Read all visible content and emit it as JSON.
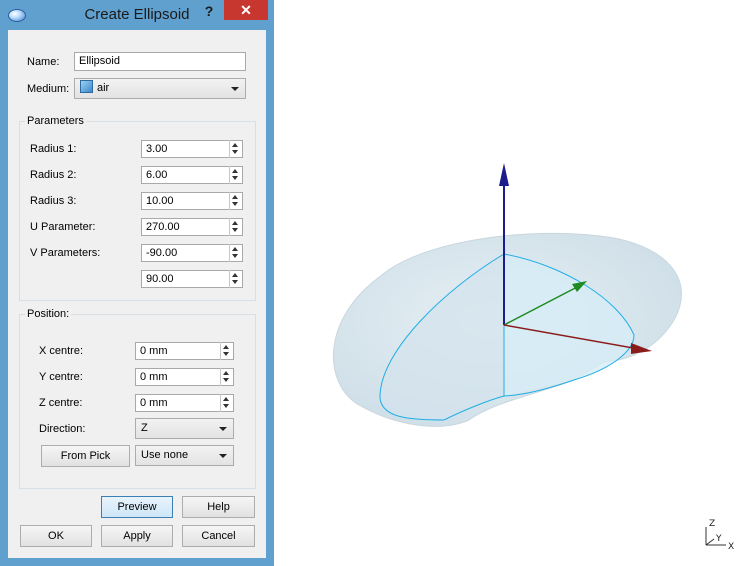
{
  "window": {
    "title": "Create Ellipsoid",
    "help_label": "?",
    "close_label": "✕"
  },
  "form": {
    "name_label": "Name:",
    "name_value": "Ellipsoid",
    "medium_label": "Medium:",
    "medium_value": "air"
  },
  "parameters": {
    "title": "Parameters",
    "rows": [
      {
        "label": "Radius 1:",
        "value": "3.00"
      },
      {
        "label": "Radius 2:",
        "value": "6.00"
      },
      {
        "label": "Radius 3:",
        "value": "10.00"
      },
      {
        "label": "U Parameter:",
        "value": "270.00"
      },
      {
        "label": "V Parameters:",
        "value": "-90.00"
      },
      {
        "label": "",
        "value": "90.00"
      }
    ]
  },
  "position": {
    "title": "Position:",
    "x_label": "X centre:",
    "x_value": "0 mm",
    "y_label": "Y centre:",
    "y_value": "0 mm",
    "z_label": "Z centre:",
    "z_value": "0 mm",
    "direction_label": "Direction:",
    "direction_value": "Z",
    "from_pick_label": "From Pick",
    "use_value": "Use none"
  },
  "buttons": {
    "preview": "Preview",
    "help": "Help",
    "ok": "OK",
    "apply": "Apply",
    "cancel": "Cancel"
  },
  "view": {
    "triad_z": "Z",
    "triad_y": "Y",
    "triad_x": "X",
    "colors": {
      "z_axis": "#1c1c8c",
      "y_axis": "#1f8a1f",
      "x_axis": "#8a1c1c",
      "shape_fill": "#d8e6ee",
      "edge": "#20aee6"
    }
  }
}
